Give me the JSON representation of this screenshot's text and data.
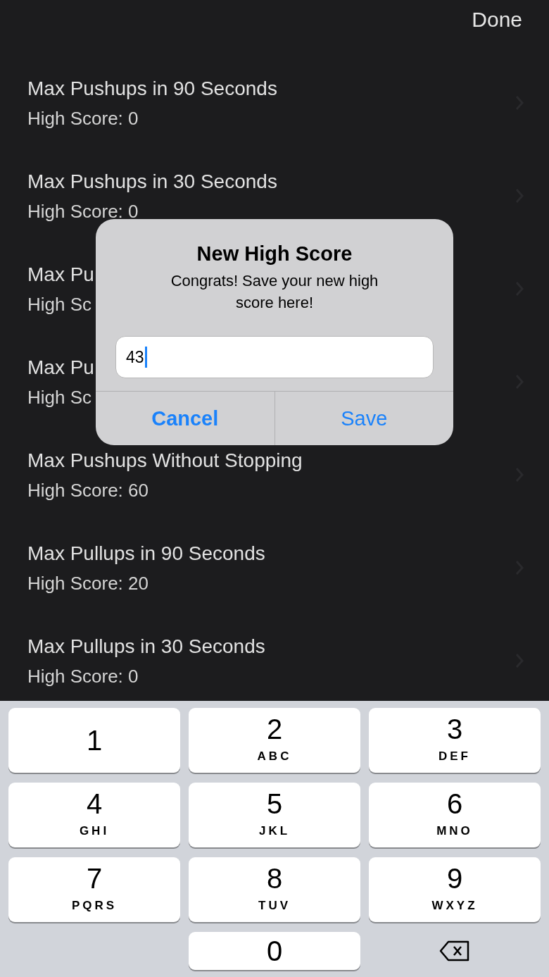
{
  "nav": {
    "done": "Done"
  },
  "rows": [
    {
      "title": "Max Pushups in 90 Seconds",
      "score": "High Score: 0"
    },
    {
      "title": "Max Pushups in 30 Seconds",
      "score": "High Score: 0"
    },
    {
      "title": "Max Pu",
      "score": "High Sc"
    },
    {
      "title": "Max Pu",
      "score": "High Sc"
    },
    {
      "title": "Max Pushups Without Stopping",
      "score": "High Score: 60"
    },
    {
      "title": "Max Pullups in 90 Seconds",
      "score": "High Score: 20"
    },
    {
      "title": "Max Pullups in 30 Seconds",
      "score": "High Score: 0"
    }
  ],
  "alert": {
    "title": "New High Score",
    "message": "Congrats! Save your new high score here!",
    "field": {
      "value": "43",
      "focused": true
    },
    "buttons": [
      {
        "label": "Cancel",
        "kind": "cancel"
      },
      {
        "label": "Save",
        "kind": "default"
      }
    ]
  },
  "keyboard": {
    "rows": [
      [
        {
          "kind": "digit",
          "digit": "1"
        },
        {
          "kind": "digit",
          "digit": "2",
          "letters": "ABC"
        },
        {
          "kind": "digit",
          "digit": "3",
          "letters": "DEF"
        }
      ],
      [
        {
          "kind": "digit",
          "digit": "4",
          "letters": "GHI"
        },
        {
          "kind": "digit",
          "digit": "5",
          "letters": "JKL"
        },
        {
          "kind": "digit",
          "digit": "6",
          "letters": "MNO"
        }
      ],
      [
        {
          "kind": "digit",
          "digit": "7",
          "letters": "PQRS"
        },
        {
          "kind": "digit",
          "digit": "8",
          "letters": "TUV"
        },
        {
          "kind": "digit",
          "digit": "9",
          "letters": "WXYZ"
        }
      ],
      [
        {
          "kind": "blank"
        },
        {
          "kind": "digit",
          "digit": "0"
        },
        {
          "kind": "delete"
        }
      ]
    ]
  }
}
